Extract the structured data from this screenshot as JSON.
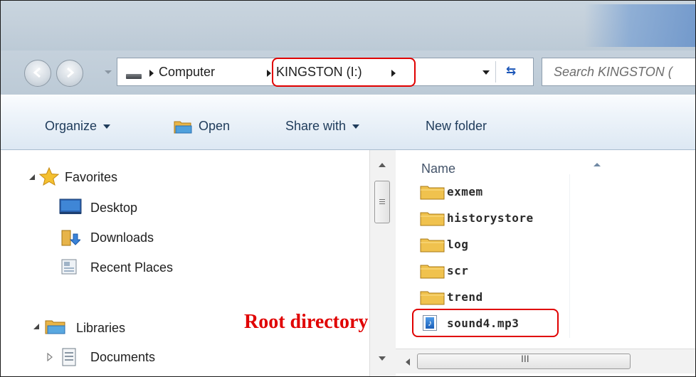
{
  "address_bar": {
    "crumbs": [
      "Computer",
      "KINGSTON (I:)"
    ],
    "search_placeholder": "Search KINGSTON ("
  },
  "toolbar": {
    "organize": "Organize",
    "open": "Open",
    "share_with": "Share with",
    "new_folder": "New folder"
  },
  "navigation_pane": {
    "favorites": {
      "label": "Favorites",
      "items": [
        "Desktop",
        "Downloads",
        "Recent Places"
      ]
    },
    "libraries": {
      "label": "Libraries",
      "items": [
        "Documents"
      ]
    }
  },
  "file_list": {
    "column_name": "Name",
    "items": [
      {
        "name": "exmem",
        "type": "folder"
      },
      {
        "name": "historystore",
        "type": "folder"
      },
      {
        "name": "log",
        "type": "folder"
      },
      {
        "name": "scr",
        "type": "folder"
      },
      {
        "name": "trend",
        "type": "folder"
      },
      {
        "name": "sound4.mp3",
        "type": "mp3"
      }
    ],
    "scroll_grip": "III"
  },
  "annotation": {
    "label": "Root directory",
    "color": "#e00000"
  }
}
